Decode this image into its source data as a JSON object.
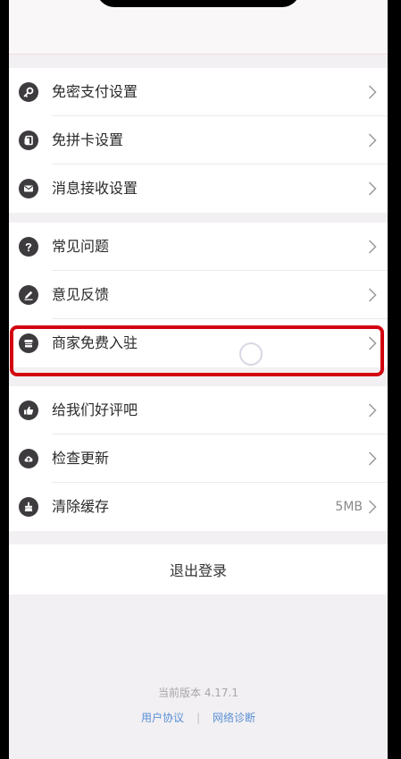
{
  "settings": {
    "group1": [
      {
        "icon": "key-icon",
        "label": "免密支付设置"
      },
      {
        "icon": "card-icon",
        "label": "免拼卡设置"
      },
      {
        "icon": "mail-icon",
        "label": "消息接收设置"
      }
    ],
    "group2": [
      {
        "icon": "question-icon",
        "label": "常见问题"
      },
      {
        "icon": "pencil-icon",
        "label": "意见反馈"
      },
      {
        "icon": "store-icon",
        "label": "商家免费入驻"
      }
    ],
    "group3": [
      {
        "icon": "thumbs-up-icon",
        "label": "给我们好评吧"
      },
      {
        "icon": "upload-icon",
        "label": "检查更新"
      },
      {
        "icon": "broom-icon",
        "label": "清除缓存",
        "value": "5MB"
      }
    ]
  },
  "logout_label": "退出登录",
  "footer": {
    "version": "当前版本 4.17.1",
    "user_agreement": "用户协议",
    "separator": "|",
    "network_diagnosis": "网络诊断"
  },
  "colors": {
    "highlight": "#d3000f",
    "link": "#5a8fd6",
    "icon_bg": "#3e3b3e"
  }
}
